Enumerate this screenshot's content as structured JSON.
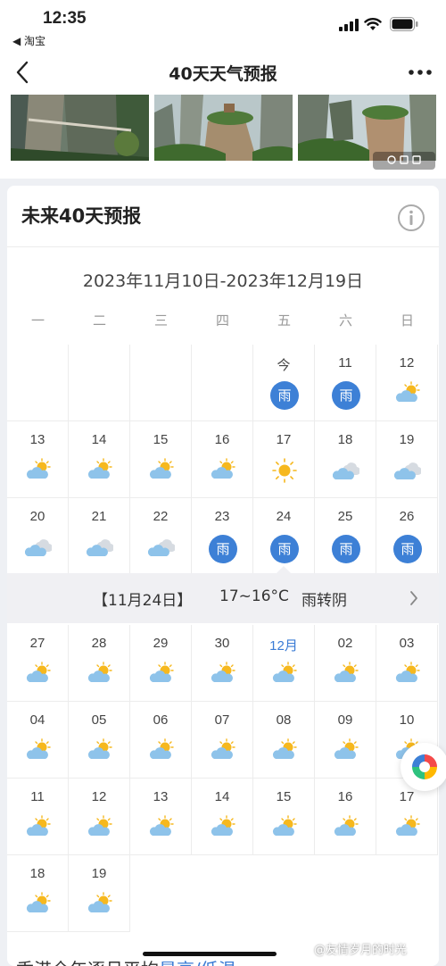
{
  "status_bar": {
    "time": "12:35",
    "back_app": "◀ 淘宝"
  },
  "nav": {
    "title": "40天天气预报"
  },
  "photos": [
    "cliff-walkway",
    "rock-pillar",
    "rock-pillar-2"
  ],
  "card": {
    "title": "未来40天预报",
    "date_range": "2023年11月10日-2023年12月19日",
    "weekdays": [
      "一",
      "二",
      "三",
      "四",
      "五",
      "六",
      "日"
    ],
    "days": [
      {
        "label": "今",
        "weather": "rain",
        "badge": "雨",
        "col": 4,
        "row": 0
      },
      {
        "label": "11",
        "weather": "rain",
        "badge": "雨",
        "col": 5,
        "row": 0
      },
      {
        "label": "12",
        "weather": "partly-cloudy",
        "col": 6,
        "row": 0
      },
      {
        "label": "13",
        "weather": "partly-cloudy",
        "col": 0,
        "row": 1
      },
      {
        "label": "14",
        "weather": "partly-cloudy",
        "col": 1,
        "row": 1
      },
      {
        "label": "15",
        "weather": "partly-cloudy",
        "col": 2,
        "row": 1
      },
      {
        "label": "16",
        "weather": "partly-cloudy",
        "col": 3,
        "row": 1
      },
      {
        "label": "17",
        "weather": "sunny",
        "col": 4,
        "row": 1
      },
      {
        "label": "18",
        "weather": "cloudy",
        "col": 5,
        "row": 1
      },
      {
        "label": "19",
        "weather": "cloudy",
        "col": 6,
        "row": 1
      },
      {
        "label": "20",
        "weather": "cloudy",
        "col": 0,
        "row": 2
      },
      {
        "label": "21",
        "weather": "cloudy",
        "col": 1,
        "row": 2
      },
      {
        "label": "22",
        "weather": "cloudy",
        "col": 2,
        "row": 2
      },
      {
        "label": "23",
        "weather": "rain",
        "badge": "雨",
        "col": 3,
        "row": 2
      },
      {
        "label": "24",
        "weather": "rain",
        "badge": "雨",
        "col": 4,
        "row": 2
      },
      {
        "label": "25",
        "weather": "rain",
        "badge": "雨",
        "col": 5,
        "row": 2
      },
      {
        "label": "26",
        "weather": "rain",
        "badge": "雨",
        "col": 6,
        "row": 2
      },
      {
        "label": "27",
        "weather": "partly-cloudy",
        "col": 0,
        "row": 3
      },
      {
        "label": "28",
        "weather": "partly-cloudy",
        "col": 1,
        "row": 3
      },
      {
        "label": "29",
        "weather": "partly-cloudy",
        "col": 2,
        "row": 3
      },
      {
        "label": "30",
        "weather": "partly-cloudy",
        "col": 3,
        "row": 3
      },
      {
        "label": "12月",
        "weather": "partly-cloudy",
        "month": true,
        "col": 4,
        "row": 3
      },
      {
        "label": "02",
        "weather": "partly-cloudy",
        "col": 5,
        "row": 3
      },
      {
        "label": "03",
        "weather": "partly-cloudy",
        "col": 6,
        "row": 3
      },
      {
        "label": "04",
        "weather": "partly-cloudy",
        "col": 0,
        "row": 4
      },
      {
        "label": "05",
        "weather": "partly-cloudy",
        "col": 1,
        "row": 4
      },
      {
        "label": "06",
        "weather": "partly-cloudy",
        "col": 2,
        "row": 4
      },
      {
        "label": "07",
        "weather": "partly-cloudy",
        "col": 3,
        "row": 4
      },
      {
        "label": "08",
        "weather": "partly-cloudy",
        "col": 4,
        "row": 4
      },
      {
        "label": "09",
        "weather": "partly-cloudy",
        "col": 5,
        "row": 4
      },
      {
        "label": "10",
        "weather": "partly-cloudy",
        "col": 6,
        "row": 4
      },
      {
        "label": "11",
        "weather": "partly-cloudy",
        "col": 0,
        "row": 5
      },
      {
        "label": "12",
        "weather": "partly-cloudy",
        "col": 1,
        "row": 5
      },
      {
        "label": "13",
        "weather": "partly-cloudy",
        "col": 2,
        "row": 5
      },
      {
        "label": "14",
        "weather": "partly-cloudy",
        "col": 3,
        "row": 5
      },
      {
        "label": "15",
        "weather": "partly-cloudy",
        "col": 4,
        "row": 5
      },
      {
        "label": "16",
        "weather": "partly-cloudy",
        "col": 5,
        "row": 5
      },
      {
        "label": "17",
        "weather": "partly-cloudy",
        "col": 6,
        "row": 5
      },
      {
        "label": "18",
        "weather": "partly-cloudy",
        "col": 0,
        "row": 6
      },
      {
        "label": "19",
        "weather": "partly-cloudy",
        "col": 1,
        "row": 6
      }
    ],
    "detail": {
      "date": "【11月24日】",
      "temp": "17~16°C",
      "desc": "雨转阴"
    }
  },
  "bottom": {
    "prefix": "香港全年逐月平均",
    "link": "最高/低温"
  },
  "watermark": "@友情岁月的时光",
  "colors": {
    "accent": "#3d80d6",
    "sun": "#f6b81e",
    "cloud": "#8ec3ea"
  }
}
